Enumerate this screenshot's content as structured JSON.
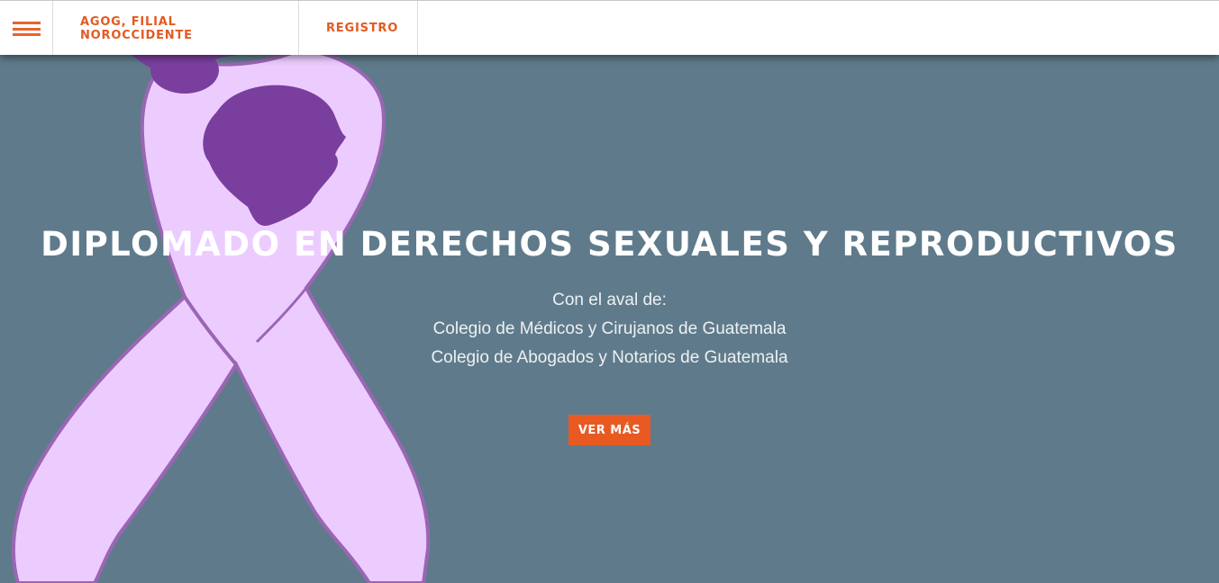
{
  "nav": {
    "menu_icon": "hamburger-menu-icon",
    "links": [
      {
        "label": "AGOG, FILIAL NOROCCIDENTE"
      },
      {
        "label": "REGISTRO"
      }
    ]
  },
  "hero": {
    "title": "DIPLOMADO EN DERECHOS SEXUALES Y REPRODUCTIVOS",
    "lines": [
      "Con el aval de:",
      "Colegio de Médicos y Cirujanos de Guatemala",
      "Colegio de Abogados y Notarios de Guatemala"
    ],
    "cta_label": "VER MÁS",
    "image": "awareness-ribbon-woman-silhouette"
  },
  "colors": {
    "background": "#5f7b8b",
    "accent": "#e85a22",
    "ribbon": "#ecccff",
    "ribbon_outline": "#9a66b4",
    "silhouette": "#7a3f9e"
  }
}
